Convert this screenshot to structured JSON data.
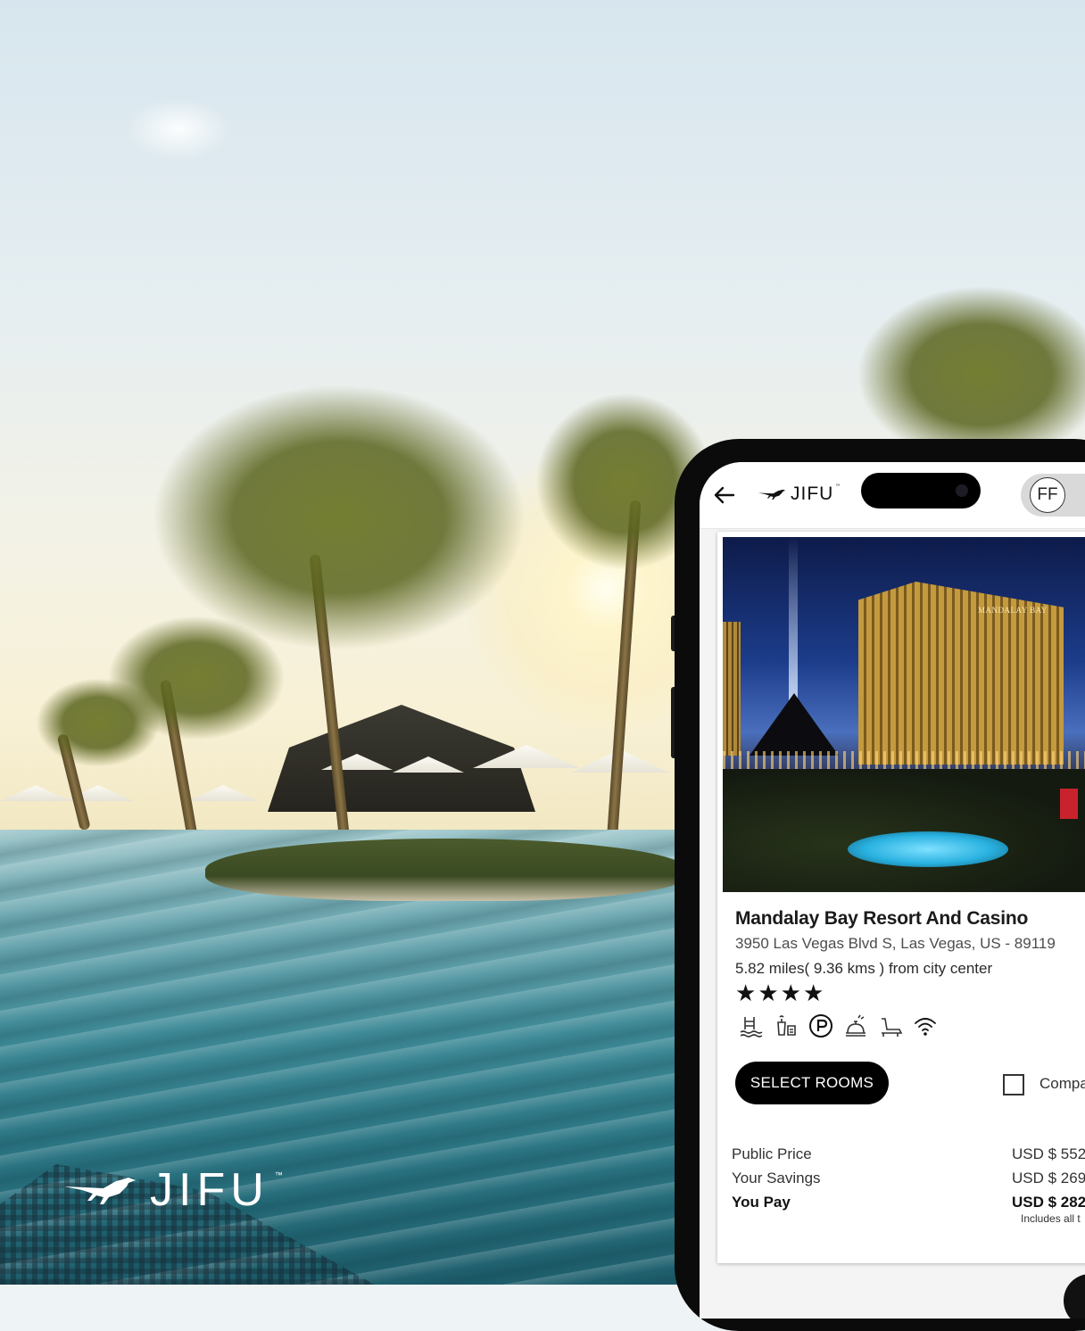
{
  "brand": {
    "name": "JIFU",
    "trademark": "™"
  },
  "app_bar": {
    "logo_text": "JIFU",
    "logo_trademark": "™",
    "avatar_initials": "FF",
    "back_icon": "arrow-left-icon"
  },
  "hotel": {
    "image_sign": "MANDALAY BAY",
    "name": "Mandalay Bay Resort And Casino",
    "address": "3950 Las Vegas Blvd S, Las Vegas, US - 89119",
    "distance": "5.82 miles( 9.36 kms ) from city center",
    "star_rating": 4,
    "star_glyph": "★",
    "amenities": [
      "pool-icon",
      "spa-icon",
      "parking-icon",
      "room-service-icon",
      "fitness-icon",
      "wifi-icon"
    ]
  },
  "actions": {
    "select_rooms": "SELECT ROOMS",
    "compare": "Compa"
  },
  "pricing": {
    "public_price_label": "Public Price",
    "public_price_value": "USD $ 552",
    "savings_label": "Your Savings",
    "savings_value": "USD $ 269",
    "you_pay_label": "You Pay",
    "you_pay_value": "USD $ 282",
    "tax_note": "Includes all t"
  }
}
